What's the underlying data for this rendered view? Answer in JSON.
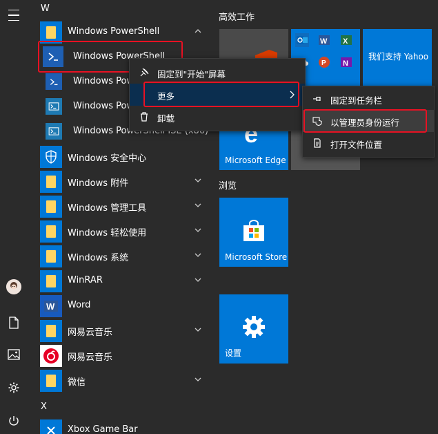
{
  "list": {
    "letter_w": "W",
    "letter_x": "X",
    "items": [
      {
        "label": "Windows PowerShell"
      },
      {
        "label": "Windows PowerShell"
      },
      {
        "label": "Windows PowerShell"
      },
      {
        "label": "Windows PowerShell"
      },
      {
        "label": "Windows PowerShell ISE (x86)"
      },
      {
        "label": "Windows 安全中心"
      },
      {
        "label": "Windows 附件"
      },
      {
        "label": "Windows 管理工具"
      },
      {
        "label": "Windows 轻松使用"
      },
      {
        "label": "Windows 系统"
      },
      {
        "label": "WinRAR"
      },
      {
        "label": "Word"
      },
      {
        "label": "网易云音乐"
      },
      {
        "label": "网易云音乐"
      },
      {
        "label": "微信"
      },
      {
        "label": "Xbox Game Bar"
      }
    ]
  },
  "tiles": {
    "group1": "高效工作",
    "group2": "浏览",
    "yahoo": "我们支持 Yahoo",
    "edge": "Microsoft Edge",
    "store": "Microsoft Store",
    "settings": "设置"
  },
  "menu1": {
    "pin_start": "固定到\"开始\"屏幕",
    "more": "更多",
    "uninstall": "卸载"
  },
  "menu2": {
    "pin_taskbar": "固定到任务栏",
    "run_admin": "以管理员身份运行",
    "open_location": "打开文件位置"
  },
  "colors": {
    "accent": "#0078d7",
    "highlight": "#e81123",
    "background": "#2b2b2b"
  }
}
